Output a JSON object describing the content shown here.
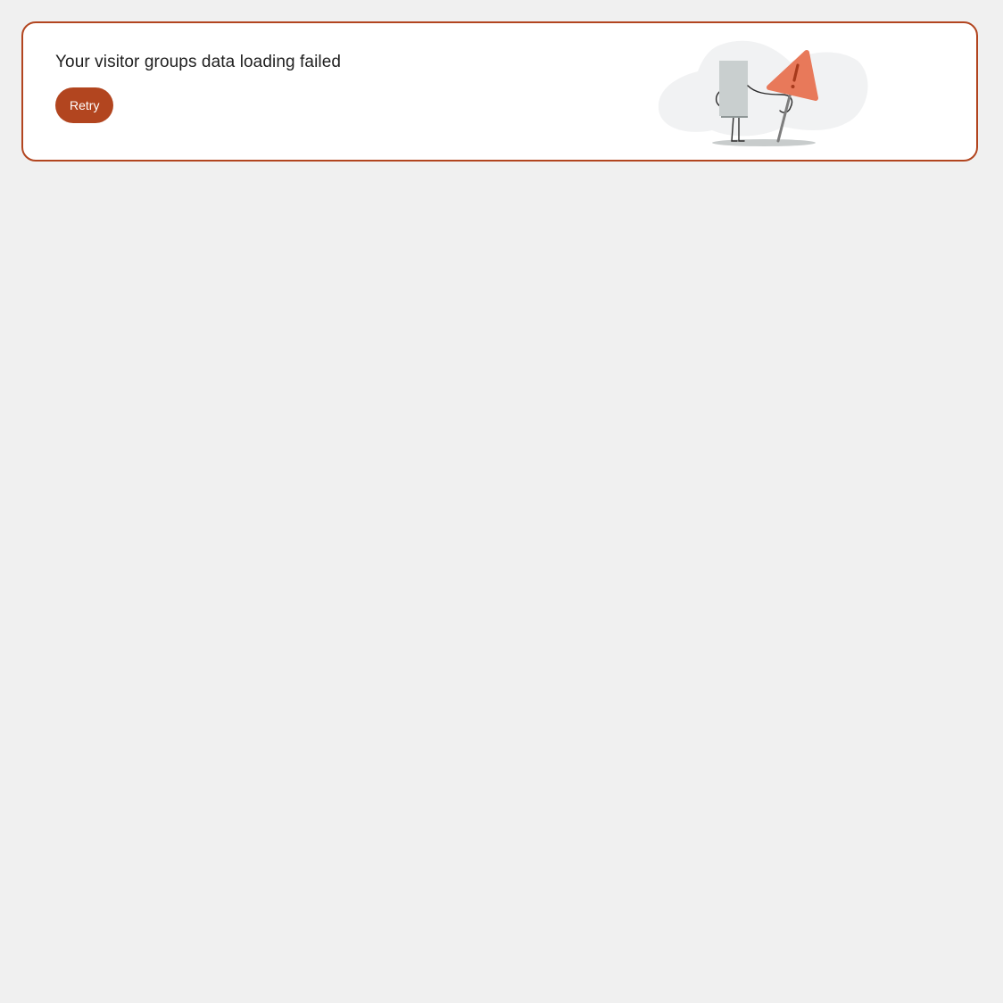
{
  "error_card": {
    "message": "Your visitor groups data loading failed",
    "retry_label": "Retry",
    "illustration_icon": "warning-sign-character-illustration"
  },
  "colors": {
    "accent": "#b2451f",
    "page_background": "#f0f0f0",
    "card_background": "#ffffff",
    "warning_sign": "#e8795a",
    "figure": "#c9cfcf"
  }
}
